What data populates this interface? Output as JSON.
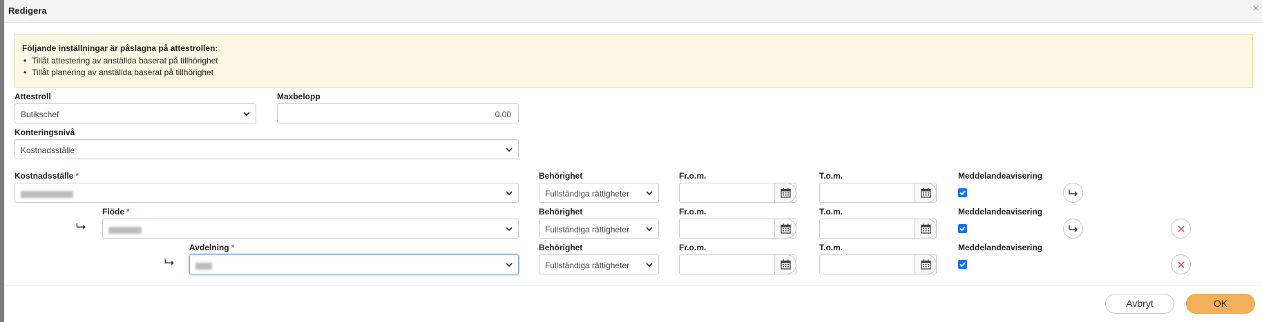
{
  "modal": {
    "title": "Redigera",
    "close_glyph": "×"
  },
  "notice": {
    "title": "Följande inställningar är påslagna på attestrollen:",
    "items": [
      "Tillåt attestering av anställda baserat på tillhörighet",
      "Tillåt planering av anställda baserat på tillhörighet"
    ]
  },
  "form": {
    "attestroll_label": "Attestroll",
    "attestroll_value": "Butikschef",
    "maxbelopp_label": "Maxbelopp",
    "maxbelopp_value": "0,00",
    "konteringsniva_label": "Konteringsnivå",
    "konteringsniva_value": "Kostnadsställe"
  },
  "rows": [
    {
      "label": "Kostnadsställe",
      "behorighet_label": "Behörighet",
      "behorighet_value": "Fullständiga rättigheter",
      "from_label": "Fr.o.m.",
      "tom_label": "T.o.m.",
      "notify_label": "Meddelandeavisering",
      "indent_glyph": "⮡"
    },
    {
      "label": "Flöde",
      "behorighet_label": "Behörighet",
      "behorighet_value": "Fullständiga rättigheter",
      "from_label": "Fr.o.m.",
      "tom_label": "T.o.m.",
      "notify_label": "Meddelandeavisering",
      "indent_glyph": "⮡"
    },
    {
      "label": "Avdelning",
      "behorighet_label": "Behörighet",
      "behorighet_value": "Fullständiga rättigheter",
      "from_label": "Fr.o.m.",
      "tom_label": "T.o.m.",
      "notify_label": "Meddelandeavisering",
      "indent_glyph": "⮡"
    }
  ],
  "required_marker": "*",
  "footer": {
    "cancel_label": "Avbryt",
    "ok_label": "OK"
  },
  "colors": {
    "accent": "#f2b05a",
    "checkbox": "#1a73e8",
    "danger": "#d9534f",
    "notice_bg": "#fdf7e3"
  }
}
